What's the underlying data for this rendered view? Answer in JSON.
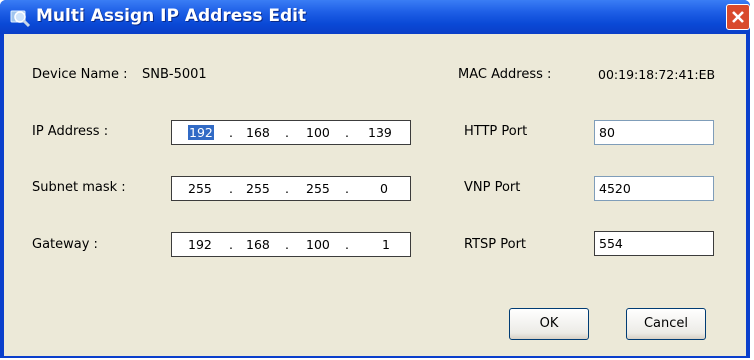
{
  "window": {
    "title": "Multi Assign IP Address Edit",
    "icon": "magnifier-icon",
    "close_icon": "close-icon"
  },
  "device": {
    "name_label": "Device Name :",
    "name_value": "SNB-5001",
    "mac_label": "MAC Address :",
    "mac_value": "00:19:18:72:41:EB"
  },
  "ip_address": {
    "label": "IP Address :",
    "octets": [
      "192",
      "168",
      "100",
      "139"
    ],
    "selected_octet": 0
  },
  "subnet_mask": {
    "label": "Subnet mask :",
    "octets": [
      "255",
      "255",
      "255",
      "0"
    ]
  },
  "gateway": {
    "label": "Gateway :",
    "octets": [
      "192",
      "168",
      "100",
      "1"
    ]
  },
  "ports": {
    "http": {
      "label": "HTTP Port",
      "value": "80"
    },
    "vnp": {
      "label": "VNP Port",
      "value": "4520"
    },
    "rtsp": {
      "label": "RTSP Port",
      "value": "554"
    }
  },
  "buttons": {
    "ok": "OK",
    "cancel": "Cancel"
  },
  "colors": {
    "titlebar": "#0a49d6",
    "dialog_bg": "#ece9d8",
    "selection": "#316ac5",
    "close_button": "#d94a2c"
  }
}
